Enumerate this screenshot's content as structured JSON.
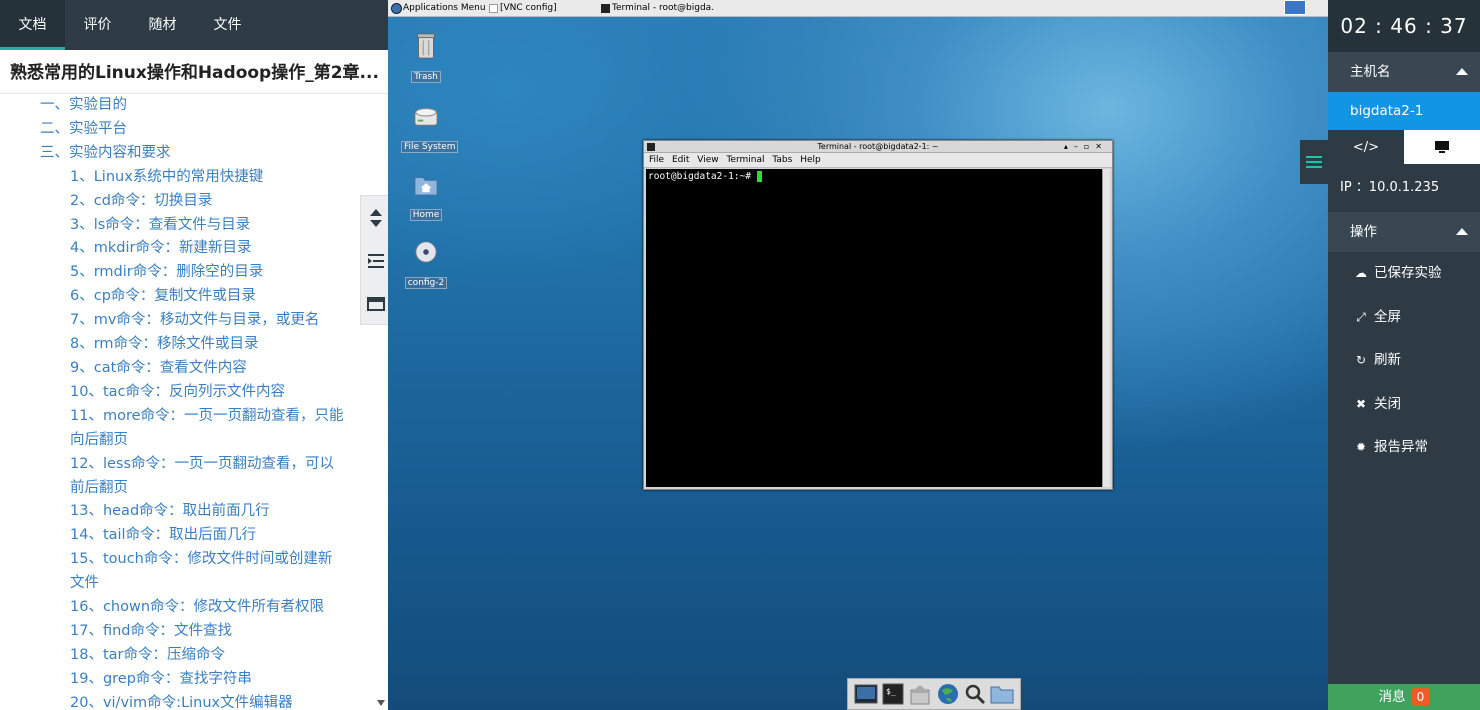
{
  "tabs": [
    "文档",
    "评价",
    "随材",
    "文件"
  ],
  "doc_title": "熟悉常用的Linux操作和Hadoop操作_第2章...",
  "toc": [
    {
      "level": 1,
      "text": "一、实验目的"
    },
    {
      "level": 1,
      "text": "二、实验平台"
    },
    {
      "level": 1,
      "text": "三、实验内容和要求"
    },
    {
      "level": 2,
      "text": "1、Linux系统中的常用快捷键"
    },
    {
      "level": 2,
      "text": "2、cd命令：切换目录"
    },
    {
      "level": 2,
      "text": "3、ls命令：查看文件与目录"
    },
    {
      "level": 2,
      "text": "4、mkdir命令：新建新目录"
    },
    {
      "level": 2,
      "text": "5、rmdir命令：删除空的目录"
    },
    {
      "level": 2,
      "text": "6、cp命令：复制文件或目录"
    },
    {
      "level": 2,
      "text": "7、mv命令：移动文件与目录，或更名"
    },
    {
      "level": 2,
      "text": "8、rm命令：移除文件或目录"
    },
    {
      "level": 2,
      "text": "9、cat命令：查看文件内容"
    },
    {
      "level": 2,
      "text": "10、tac命令：反向列示文件内容"
    },
    {
      "level": 2,
      "text": "11、more命令：一页一页翻动查看，只能向后翻页"
    },
    {
      "level": 2,
      "text": "12、less命令：一页一页翻动查看，可以前后翻页"
    },
    {
      "level": 2,
      "text": "13、head命令：取出前面几行"
    },
    {
      "level": 2,
      "text": "14、tail命令：取出后面几行"
    },
    {
      "level": 2,
      "text": "15、touch命令：修改文件时间或创建新文件"
    },
    {
      "level": 2,
      "text": "16、chown命令：修改文件所有者权限"
    },
    {
      "level": 2,
      "text": "17、find命令：文件查找"
    },
    {
      "level": 2,
      "text": "18、tar命令：压缩命令"
    },
    {
      "level": 2,
      "text": "19、grep命令：查找字符串"
    },
    {
      "level": 2,
      "text": "20、vi/vim命令:Linux文件编辑器"
    }
  ],
  "tool_icons": [
    "expand-collapse-icon",
    "outline-indent-icon",
    "window-icon"
  ],
  "desktop": {
    "taskbar": {
      "apps_menu": "Applications Menu",
      "task1": "[VNC config]",
      "task2": "Terminal - root@bigda..."
    },
    "icons": [
      {
        "name": "trash",
        "label": "Trash"
      },
      {
        "name": "filesystem",
        "label": "File System"
      },
      {
        "name": "home",
        "label": "Home"
      },
      {
        "name": "config",
        "label": "config-2"
      }
    ],
    "terminal": {
      "title": "Terminal - root@bigdata2-1: ~",
      "menu": [
        "File",
        "Edit",
        "View",
        "Terminal",
        "Tabs",
        "Help"
      ],
      "prompt": "root@bigdata2-1:~# "
    }
  },
  "right": {
    "clock": "02 : 46 : 37",
    "hostname_header": "主机名",
    "hostname": "bigdata2-1",
    "ip": "IP ：10.0.1.235",
    "ops_header": "操作",
    "ops": [
      "已保存实验",
      "全屏",
      "刷新",
      "关闭",
      "报告异常"
    ],
    "message_label": "消息",
    "message_count": "0"
  },
  "colors": {
    "accent_blue": "#1296e3",
    "dark_panel": "#2e3b44",
    "link": "#3a7fc4",
    "message_green": "#3fa35d",
    "badge_orange": "#f05a23"
  }
}
